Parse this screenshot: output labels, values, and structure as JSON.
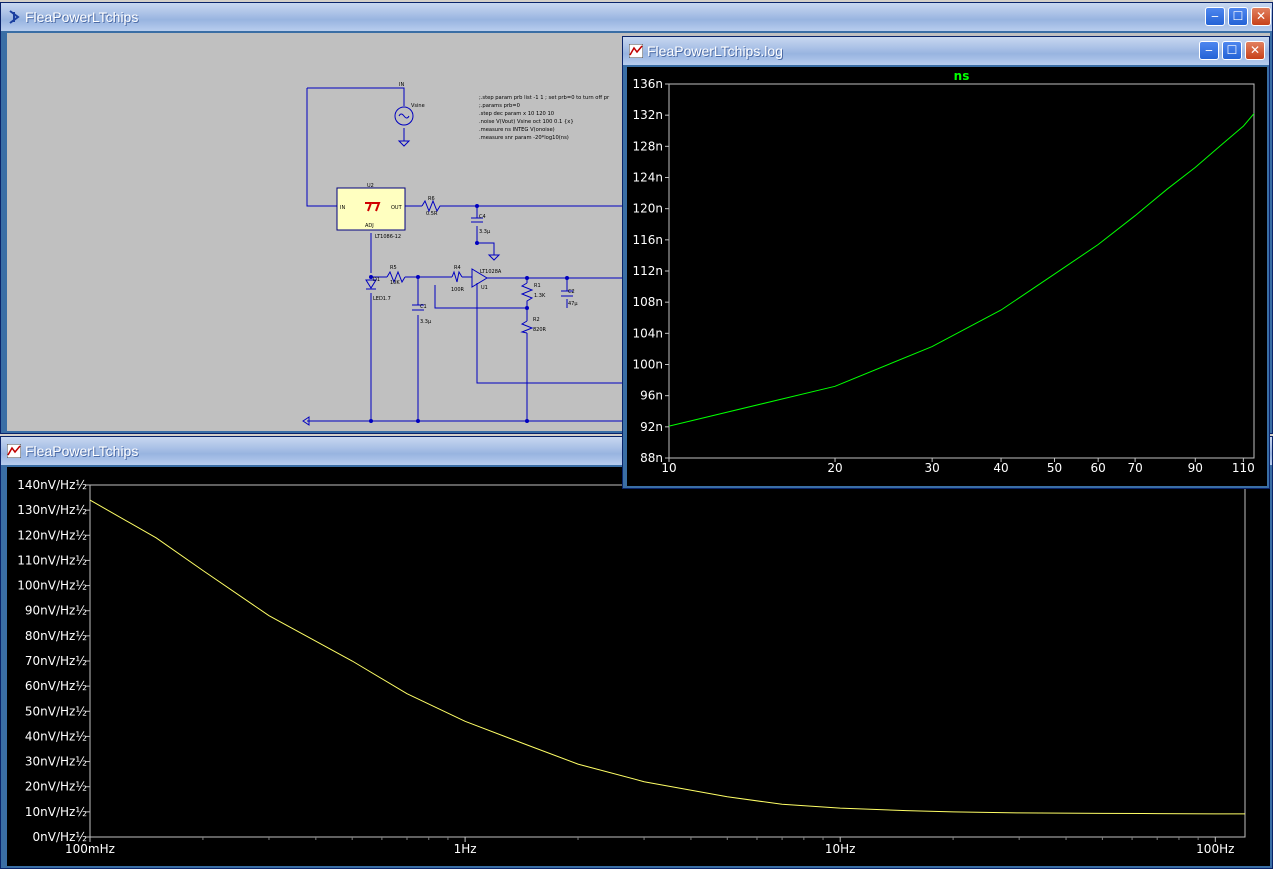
{
  "schematic_window": {
    "title": "FleaPowerLTchips",
    "icon": "ltspice-schematic-icon",
    "labels": {
      "in": "IN",
      "vsine": "Vsine",
      "u2": "U2",
      "u2_in": "IN",
      "u2_out": "OUT",
      "u2_adj": "ADJ",
      "u2_part": "LT1086-12",
      "r6": "R6",
      "r6_val": "0.5R",
      "c4": "C4",
      "c4_val": "3.3µ",
      "d1": "D1",
      "led": "LED1.7",
      "r5": "R5",
      "r5_val": "10K",
      "r4": "R4",
      "r4_val": "100R",
      "u1_part": "LT1028A",
      "u1": "U1",
      "c1": "C1",
      "c1_val": "3.3µ",
      "r1": "R1",
      "r1_val": "1.3K",
      "c2": "C2",
      "c2_val": "47µ",
      "r2": "R2",
      "r2_val": "820R"
    },
    "directives": [
      ";.step param prb list -1 1 ; set prb=0 to turn off pr",
      ";.params prb=0",
      ".step dec param x 10 120 10",
      ".noise V(Vout) Vsine oct 100 0.1 {x}",
      ".measure ns INTEG V(onoise)",
      ".measure snr param -20*log10(ns)"
    ]
  },
  "log_window": {
    "title": "FleaPowerLTchips.log",
    "icon": "waveform-icon",
    "chart_data": {
      "type": "line",
      "title": "ns",
      "x": [
        10,
        20,
        30,
        40,
        50,
        60,
        70,
        80,
        90,
        100,
        110,
        115
      ],
      "y": [
        92.1,
        97.2,
        102.3,
        107.0,
        111.6,
        115.4,
        119.1,
        122.5,
        125.3,
        128.1,
        130.6,
        132.2
      ],
      "xlim": [
        10,
        115
      ],
      "ylim": [
        88,
        136
      ],
      "xticks": [
        "10",
        "20",
        "30",
        "40",
        "50",
        "60",
        "70",
        "90",
        "110"
      ],
      "yticks": [
        "136n",
        "132n",
        "128n",
        "124n",
        "120n",
        "116n",
        "112n",
        "108n",
        "104n",
        "100n",
        "96n",
        "92n",
        "88n"
      ],
      "x_scale": "log",
      "color": "#00ff00"
    }
  },
  "noise_window": {
    "title": "FleaPowerLTchips",
    "icon": "waveform-icon",
    "chart_data": {
      "type": "line",
      "x_scale": "log",
      "x": [
        0.1,
        0.15,
        0.2,
        0.3,
        0.5,
        0.7,
        1,
        1.5,
        2,
        3,
        5,
        7,
        10,
        15,
        20,
        30,
        50,
        70,
        100,
        120
      ],
      "y": [
        134,
        119,
        106,
        88,
        70,
        57,
        46,
        36,
        29,
        22,
        16,
        13,
        11.5,
        10.5,
        10,
        9.6,
        9.4,
        9.3,
        9.2,
        9.2
      ],
      "xlim": [
        0.1,
        120
      ],
      "ylim": [
        0,
        140
      ],
      "xticks": [
        "100mHz",
        "1Hz",
        "10Hz",
        "100Hz"
      ],
      "yticks": [
        "140nV/Hz½",
        "130nV/Hz½",
        "120nV/Hz½",
        "110nV/Hz½",
        "100nV/Hz½",
        "90nV/Hz½",
        "80nV/Hz½",
        "70nV/Hz½",
        "60nV/Hz½",
        "50nV/Hz½",
        "40nV/Hz½",
        "30nV/Hz½",
        "20nV/Hz½",
        "10nV/Hz½",
        "0nV/Hz½"
      ],
      "color": "#ffff66"
    }
  },
  "buttons": {
    "minimize": "‒",
    "maximize": "☐",
    "close": "✕"
  }
}
